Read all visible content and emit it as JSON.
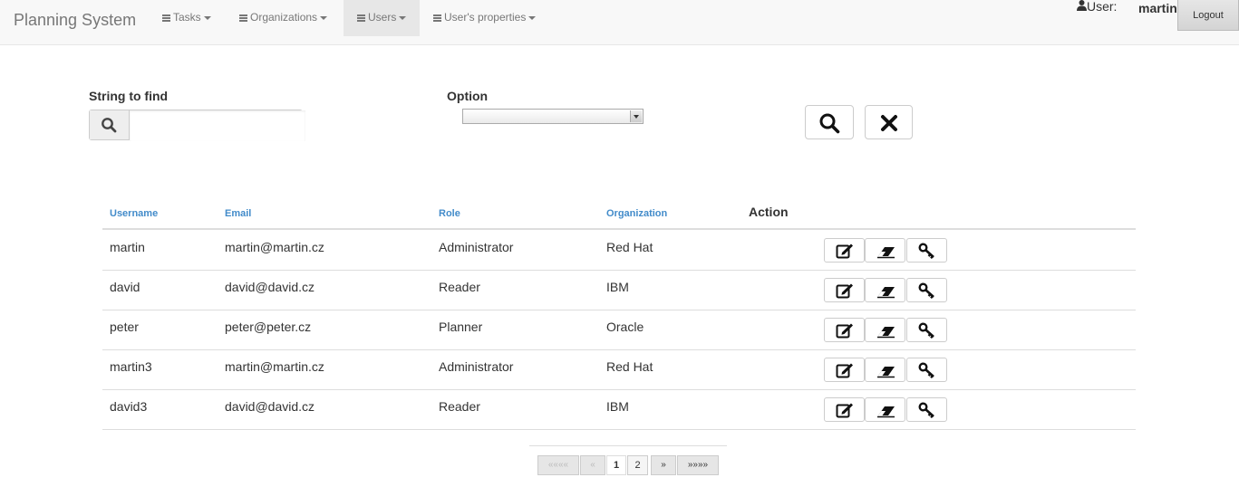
{
  "navbar": {
    "brand": "Planning System",
    "items": [
      {
        "label": "Tasks"
      },
      {
        "label": "Organizations"
      },
      {
        "label": "Users"
      },
      {
        "label": "User's properties"
      }
    ],
    "user_label": "User:",
    "user_name": "martin",
    "logout_label": "Logout"
  },
  "search": {
    "string_label": "String to find",
    "input_value": "",
    "option_label": "Option",
    "option_selected": ""
  },
  "table": {
    "headers": [
      "Username",
      "Email",
      "Role",
      "Organization"
    ],
    "action_header": "Action",
    "rows": [
      {
        "username": "martin",
        "email": "martin@martin.cz",
        "role": "Administrator",
        "organization": "Red Hat"
      },
      {
        "username": "david",
        "email": "david@david.cz",
        "role": "Reader",
        "organization": "IBM"
      },
      {
        "username": "peter",
        "email": "peter@peter.cz",
        "role": "Planner",
        "organization": "Oracle"
      },
      {
        "username": "martin3",
        "email": "martin@martin.cz",
        "role": "Administrator",
        "organization": "Red Hat"
      },
      {
        "username": "david3",
        "email": "david@david.cz",
        "role": "Reader",
        "organization": "IBM"
      }
    ]
  },
  "pagination": {
    "first": "««««",
    "prev": "«",
    "pages": [
      "1",
      "2"
    ],
    "next": "»",
    "last": "»»»»"
  },
  "icons": {
    "search": "search-icon",
    "clear": "close-icon",
    "edit": "edit-icon",
    "delete": "eraser-icon",
    "password": "key-icon",
    "user": "user-icon",
    "menu": "hamburger-icon"
  }
}
